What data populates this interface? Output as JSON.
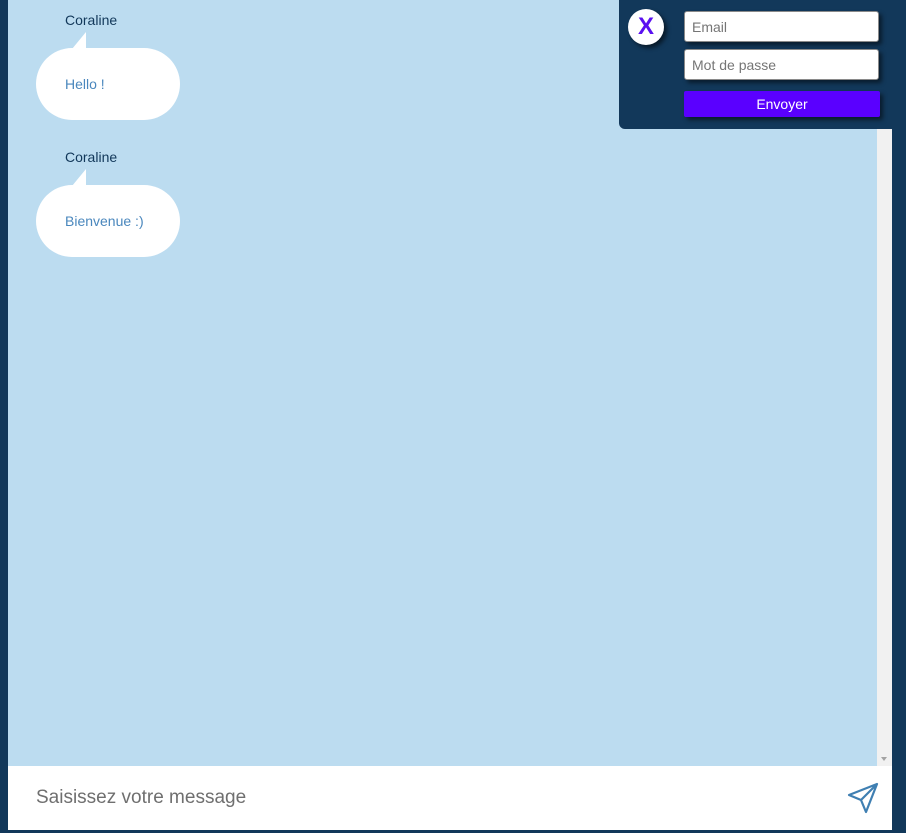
{
  "messages": [
    {
      "author": "Coraline",
      "text": "Hello !"
    },
    {
      "author": "Coraline",
      "text": "Bienvenue :)"
    }
  ],
  "login": {
    "close_label": "X",
    "email_placeholder": "Email",
    "password_placeholder": "Mot de passe",
    "submit_label": "Envoyer"
  },
  "composer": {
    "placeholder": "Saisissez votre message",
    "send_icon": "send-icon"
  },
  "colors": {
    "background": "#12385a",
    "chat_background": "#bcdcf0",
    "bubble": "#ffffff",
    "bubble_text": "#4a87bd",
    "accent": "#5a00ff"
  }
}
